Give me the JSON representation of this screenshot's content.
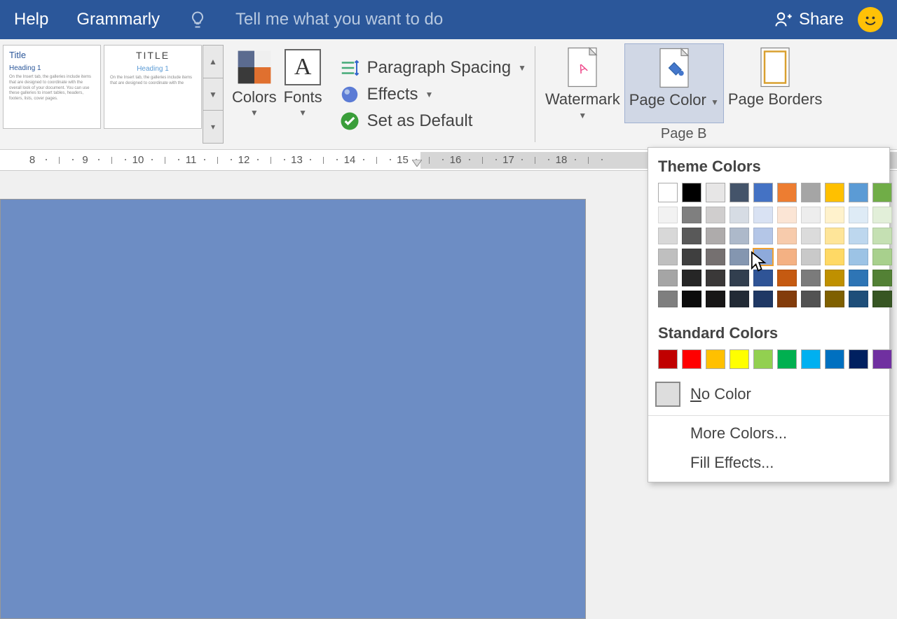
{
  "topbar": {
    "help": "Help",
    "grammarly": "Grammarly",
    "tell_me": "Tell me what you want to do",
    "share": "Share"
  },
  "gallery": {
    "card1": {
      "title": "Title",
      "heading": "Heading 1",
      "body": "On the Insert tab, the galleries include items that are designed to coordinate with the overall look of your document. You can use these galleries to insert tables, headers, footers, lists, cover pages."
    },
    "card2": {
      "title": "TITLE",
      "heading": "Heading 1",
      "body": "On the Insert tab, the galleries include items that are designed to coordinate with the"
    }
  },
  "ribbon": {
    "colors": "Colors",
    "fonts": "Fonts",
    "paragraph_spacing": "Paragraph Spacing",
    "effects": "Effects",
    "set_default": "Set as Default",
    "watermark": "Watermark",
    "page_color": "Page Color",
    "page_borders": "Page Borders",
    "group_caption": "Page B"
  },
  "ruler": {
    "numbers": [
      "8",
      "9",
      "10",
      "11",
      "12",
      "13",
      "14",
      "15",
      "16",
      "17",
      "18"
    ]
  },
  "color_panel": {
    "theme_title": "Theme Colors",
    "standard_title": "Standard Colors",
    "no_color": "No Color",
    "more_colors": "More Colors...",
    "fill_effects": "Fill Effects...",
    "theme_row": [
      "#ffffff",
      "#000000",
      "#e7e6e6",
      "#44546a",
      "#4472c4",
      "#ed7d31",
      "#a5a5a5",
      "#ffc000",
      "#5b9bd5",
      "#70ad47"
    ],
    "theme_shades": [
      [
        "#f2f2f2",
        "#7f7f7f",
        "#d0cece",
        "#d6dce4",
        "#d9e2f3",
        "#fbe5d5",
        "#ededed",
        "#fff2cc",
        "#deebf6",
        "#e2efd9"
      ],
      [
        "#d8d8d8",
        "#595959",
        "#aeabab",
        "#adb9ca",
        "#b4c6e7",
        "#f7cbac",
        "#dbdbdb",
        "#fee599",
        "#bdd7ee",
        "#c5e0b3"
      ],
      [
        "#bfbfbf",
        "#3f3f3f",
        "#757070",
        "#8496b0",
        "#8eaadb",
        "#f4b183",
        "#c9c9c9",
        "#ffd965",
        "#9cc3e5",
        "#a8d08d"
      ],
      [
        "#a5a5a5",
        "#262626",
        "#3a3838",
        "#323f4f",
        "#2f5496",
        "#c55a11",
        "#7b7b7b",
        "#bf9000",
        "#2e75b5",
        "#538135"
      ],
      [
        "#7f7f7f",
        "#0c0c0c",
        "#171616",
        "#222a35",
        "#1f3864",
        "#833c0b",
        "#525252",
        "#7f6000",
        "#1e4e79",
        "#375623"
      ]
    ],
    "standard_row": [
      "#c00000",
      "#ff0000",
      "#ffc000",
      "#ffff00",
      "#92d050",
      "#00b050",
      "#00b0f0",
      "#0070c0",
      "#002060",
      "#7030a0"
    ],
    "selected_theme_shade": [
      2,
      4
    ]
  }
}
